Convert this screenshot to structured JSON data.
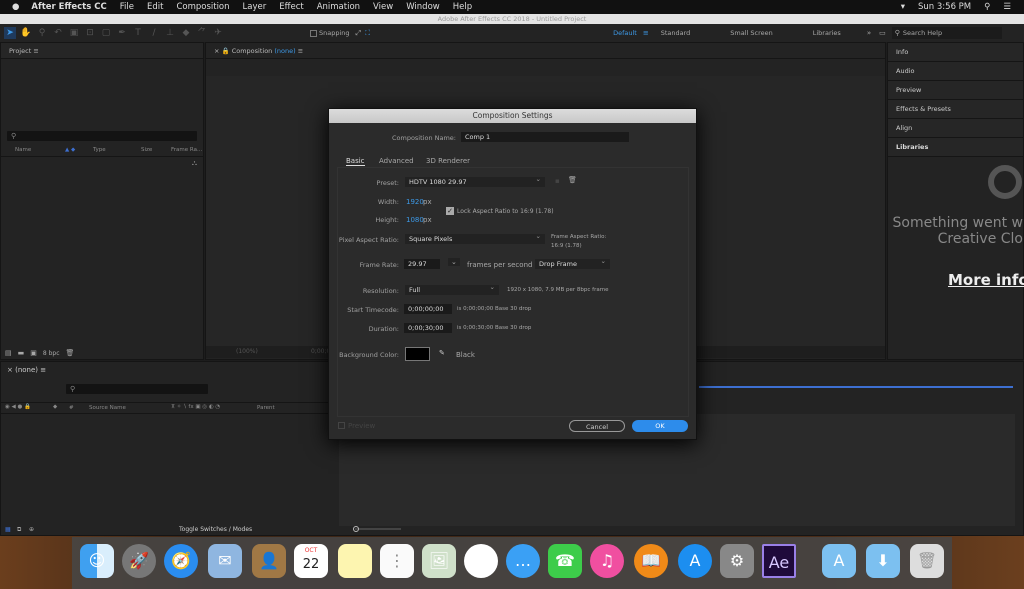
{
  "menubar": {
    "app": "After Effects CC",
    "items": [
      "File",
      "Edit",
      "Composition",
      "Layer",
      "Effect",
      "Animation",
      "View",
      "Window",
      "Help"
    ],
    "clock": "Sun 3:56 PM"
  },
  "window": {
    "title": "Adobe After Effects CC 2018 - Untitled Project"
  },
  "toolbar": {
    "snapping": "Snapping",
    "workspaces": [
      "Default",
      "Standard",
      "Small Screen",
      "Libraries"
    ],
    "search_placeholder": "Search Help"
  },
  "project": {
    "title": "Project",
    "columns": [
      "Name",
      "Type",
      "Size",
      "Frame Ra..."
    ],
    "bpc": "8 bpc"
  },
  "composition": {
    "title": "Composition",
    "name": "(none)",
    "zoom": "(100%)",
    "time": "0;00;0"
  },
  "right_panels": [
    "Info",
    "Audio",
    "Preview",
    "Effects & Presets",
    "Align",
    "Libraries"
  ],
  "libraries": {
    "error_line1": "Something went w",
    "error_line2": "Creative Clo",
    "more_info": "More info"
  },
  "timeline": {
    "name": "(none)",
    "columns": [
      "#",
      "Source Name",
      "Parent"
    ],
    "toggle": "Toggle Switches / Modes"
  },
  "dialog": {
    "title": "Composition Settings",
    "comp_name_label": "Composition Name:",
    "comp_name": "Comp 1",
    "tabs": [
      "Basic",
      "Advanced",
      "3D Renderer"
    ],
    "preset_label": "Preset:",
    "preset": "HDTV 1080 29.97",
    "width_label": "Width:",
    "width": "1920",
    "height_label": "Height:",
    "height": "1080",
    "px": "px",
    "lock_label": "Lock Aspect Ratio to 16:9 (1.78)",
    "lock_checked": true,
    "par_label": "Pixel Aspect Ratio:",
    "par": "Square Pixels",
    "far_label": "Frame Aspect Ratio:",
    "far": "16:9 (1.78)",
    "fr_label": "Frame Rate:",
    "fr": "29.97",
    "fps": "frames per second",
    "drop": "Drop Frame",
    "res_label": "Resolution:",
    "res": "Full",
    "res_info": "1920 x 1080, 7.9 MB per 8bpc frame",
    "start_label": "Start Timecode:",
    "start": "0;00;00;00",
    "start_info": "is 0;00;00;00  Base 30  drop",
    "dur_label": "Duration:",
    "dur": "0;00;30;00",
    "dur_info": "is 0;00;30;00  Base 30  drop",
    "bg_label": "Background Color:",
    "bg_name": "Black",
    "bg_color": "#000000",
    "preview": "Preview",
    "cancel": "Cancel",
    "ok": "OK"
  },
  "dock": {
    "apps": [
      "Finder",
      "Launchpad",
      "Safari",
      "Mail",
      "Contacts",
      "Calendar",
      "Notes",
      "Reminders",
      "Preview",
      "Photos",
      "Messages",
      "FaceTime",
      "iTunes",
      "iBooks",
      "App Store",
      "System Preferences",
      "After Effects",
      "Applications",
      "Downloads",
      "Trash"
    ],
    "calendar_month": "OCT",
    "calendar_day": "22",
    "ae_label": "Ae"
  },
  "colors": {
    "accent": "#2d8ceb",
    "link": "#3d9ae8"
  }
}
